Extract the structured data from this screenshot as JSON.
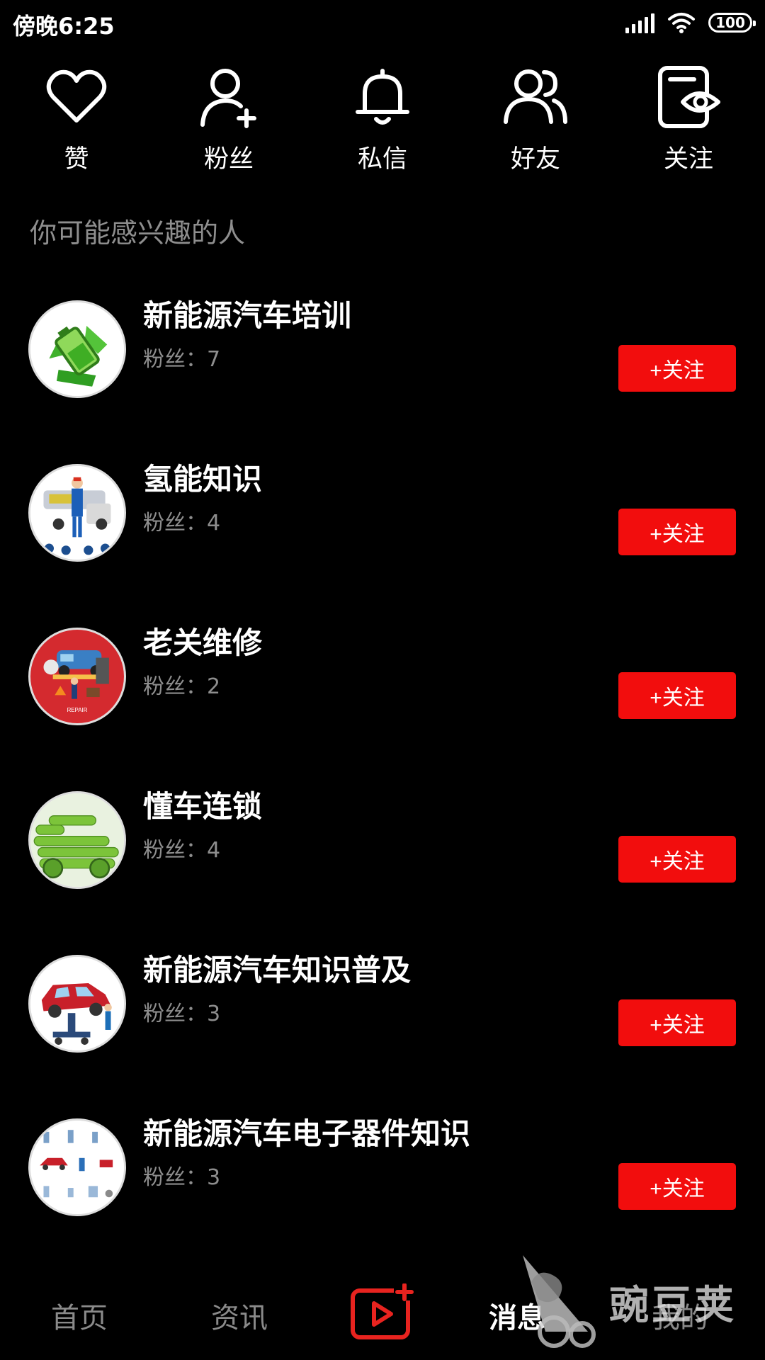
{
  "status_bar": {
    "time": "傍晚6:25",
    "battery": "100"
  },
  "quick_actions": [
    {
      "label": "赞",
      "icon": "heart-icon"
    },
    {
      "label": "粉丝",
      "icon": "user-plus-icon"
    },
    {
      "label": "私信",
      "icon": "bell-icon"
    },
    {
      "label": "好友",
      "icon": "users-icon"
    },
    {
      "label": "关注",
      "icon": "eye-document-icon"
    }
  ],
  "section_title": "你可能感兴趣的人",
  "suggestions": [
    {
      "name": "新能源汽车培训",
      "fans": "粉丝：7",
      "follow_label": "+关注",
      "avatar": "battery-recycle-avatar"
    },
    {
      "name": "氢能知识",
      "fans": "粉丝：4",
      "follow_label": "+关注",
      "avatar": "mechanic-car-avatar"
    },
    {
      "name": "老关维修",
      "fans": "粉丝：2",
      "follow_label": "+关注",
      "avatar": "repair-shop-avatar"
    },
    {
      "name": "懂车连锁",
      "fans": "粉丝：4",
      "follow_label": "+关注",
      "avatar": "green-battery-car-avatar"
    },
    {
      "name": "新能源汽车知识普及",
      "fans": "粉丝：3",
      "follow_label": "+关注",
      "avatar": "car-lift-avatar"
    },
    {
      "name": "新能源汽车电子器件知识",
      "fans": "粉丝：3",
      "follow_label": "+关注",
      "avatar": "car-icons-avatar"
    }
  ],
  "bottom_nav": {
    "home": "首页",
    "news": "资讯",
    "publish": "publish-video-icon",
    "messages": "消息",
    "me": "我的"
  },
  "watermark": "豌豆荚",
  "colors": {
    "background": "#000000",
    "accent": "#f20d0d",
    "secondary_text": "#8e8e8e"
  }
}
